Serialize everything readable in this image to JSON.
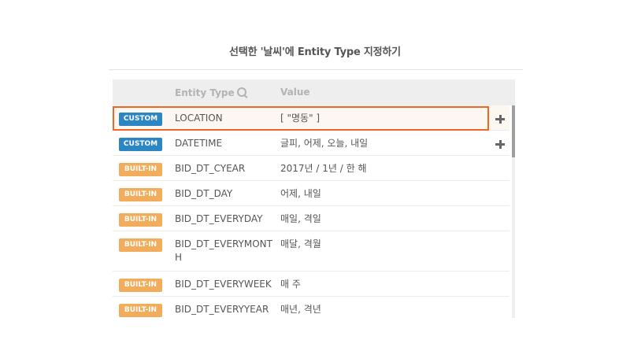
{
  "dialog": {
    "title": "선택한 '날씨'에 Entity Type 지정하기"
  },
  "table": {
    "columns": {
      "entity_type": "Entity Type",
      "value": "Value"
    },
    "rows": [
      {
        "badge": "CUSTOM",
        "kind": "custom",
        "name": "LOCATION",
        "value": "[ \"명동\" ]",
        "selected": true,
        "addable": true
      },
      {
        "badge": "CUSTOM",
        "kind": "custom",
        "name": "DATETIME",
        "value": "글피, 어제, 오늘, 내일",
        "selected": false,
        "addable": true
      },
      {
        "badge": "BUILT-IN",
        "kind": "builtin",
        "name": "BID_DT_CYEAR",
        "value": "2017년 / 1년 / 한 해",
        "selected": false,
        "addable": false
      },
      {
        "badge": "BUILT-IN",
        "kind": "builtin",
        "name": "BID_DT_DAY",
        "value": "어제, 내일",
        "selected": false,
        "addable": false
      },
      {
        "badge": "BUILT-IN",
        "kind": "builtin",
        "name": "BID_DT_EVERYDAY",
        "value": "매일, 격일",
        "selected": false,
        "addable": false
      },
      {
        "badge": "BUILT-IN",
        "kind": "builtin",
        "name": "BID_DT_EVERYMONTH",
        "value": "매달, 격월",
        "selected": false,
        "addable": false
      },
      {
        "badge": "BUILT-IN",
        "kind": "builtin",
        "name": "BID_DT_EVERYWEEK",
        "value": "매 주",
        "selected": false,
        "addable": false
      },
      {
        "badge": "BUILT-IN",
        "kind": "builtin",
        "name": "BID_DT_EVERYYEAR",
        "value": "매년, 격년",
        "selected": false,
        "addable": false
      }
    ]
  },
  "colors": {
    "custom_badge": "#2d86c4",
    "builtin_badge": "#f2ad5c",
    "highlight_border": "#f26522"
  },
  "icons": {
    "header_search": "search-icon",
    "row_add": "plus-icon"
  }
}
